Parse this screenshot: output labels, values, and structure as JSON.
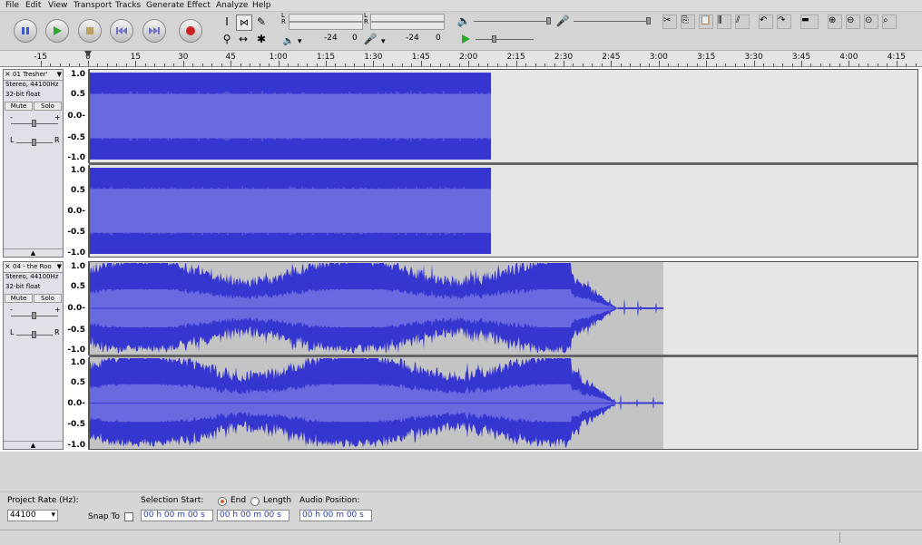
{
  "menu": [
    "File",
    "Edit",
    "View",
    "Transport",
    "Tracks",
    "Generate",
    "Effect",
    "Analyze",
    "Help"
  ],
  "transport": {
    "pause": "pause-icon",
    "play": "play-icon",
    "stop": "stop-icon",
    "skip_start": "skip-to-start-icon",
    "skip_end": "skip-to-end-icon",
    "record": "record-icon"
  },
  "meters": {
    "play_lr": "L\nR",
    "rec_lr": "L\nR",
    "play_db_left": "-24",
    "play_db_right": "0",
    "rec_db_left": "-24",
    "rec_db_right": "0"
  },
  "ruler": {
    "ticks": [
      "-15",
      "0",
      "15",
      "30",
      "45",
      "1:00",
      "1:15",
      "1:30",
      "1:45",
      "2:00",
      "2:15",
      "2:30",
      "2:45",
      "3:00",
      "3:15",
      "3:30",
      "3:45",
      "4:00",
      "4:15"
    ]
  },
  "tracks": [
    {
      "name": "01 Tresher'",
      "format": "Stereo, 44100Hz",
      "bits": "32-bit float",
      "mute": "Mute",
      "solo": "Solo",
      "pan_l": "L",
      "pan_r": "R",
      "scale": [
        "1.0",
        "0.5",
        "0.0-",
        "-0.5",
        "-1.0"
      ],
      "clip_length_seconds": 126
    },
    {
      "name": "04 - the Roo",
      "format": "Stereo, 44100Hz",
      "bits": "32-bit float",
      "mute": "Mute",
      "solo": "Solo",
      "pan_l": "L",
      "pan_r": "R",
      "scale": [
        "1.0",
        "0.5",
        "0.0-",
        "-0.5",
        "-1.0"
      ],
      "clip_length_seconds": 181
    }
  ],
  "selection": {
    "rate_label": "Project Rate (Hz):",
    "rate_value": "44100",
    "snap_label": "Snap To",
    "sel_start_label": "Selection Start:",
    "end_label": "End",
    "length_label": "Length",
    "audio_pos_label": "Audio Position:",
    "sel_start_value": "00 h 00 m 00 s",
    "sel_end_value": "00 h 00 m 00 s",
    "audio_pos_value": "00 h 00 m 00 s"
  },
  "colors": {
    "waveform_dark": "#3535d0",
    "waveform_rms": "#6a6ae0",
    "record_red": "#cc2222",
    "play_green": "#2aa82a"
  }
}
